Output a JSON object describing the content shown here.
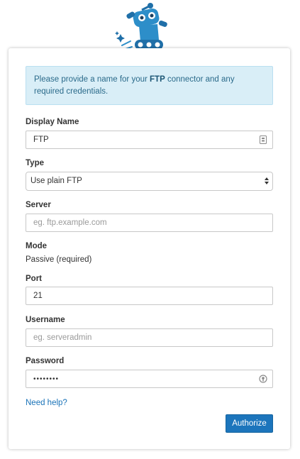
{
  "info": {
    "text_before": "Please provide a name for your ",
    "connector_name": "FTP",
    "text_after": " connector and any required credentials."
  },
  "form": {
    "display_name": {
      "label": "Display Name",
      "value": "FTP"
    },
    "type": {
      "label": "Type",
      "selected": "Use plain FTP"
    },
    "server": {
      "label": "Server",
      "placeholder": "eg. ftp.example.com"
    },
    "mode": {
      "label": "Mode",
      "value": "Passive (required)"
    },
    "port": {
      "label": "Port",
      "value": "21"
    },
    "username": {
      "label": "Username",
      "placeholder": "eg. serveradmin"
    },
    "password": {
      "label": "Password",
      "value": "••••••••"
    }
  },
  "links": {
    "help": "Need help?"
  },
  "actions": {
    "authorize": "Authorize"
  },
  "colors": {
    "accent": "#1c75bc",
    "info_bg": "#d9eef7",
    "robot": "#2d8ec9"
  }
}
